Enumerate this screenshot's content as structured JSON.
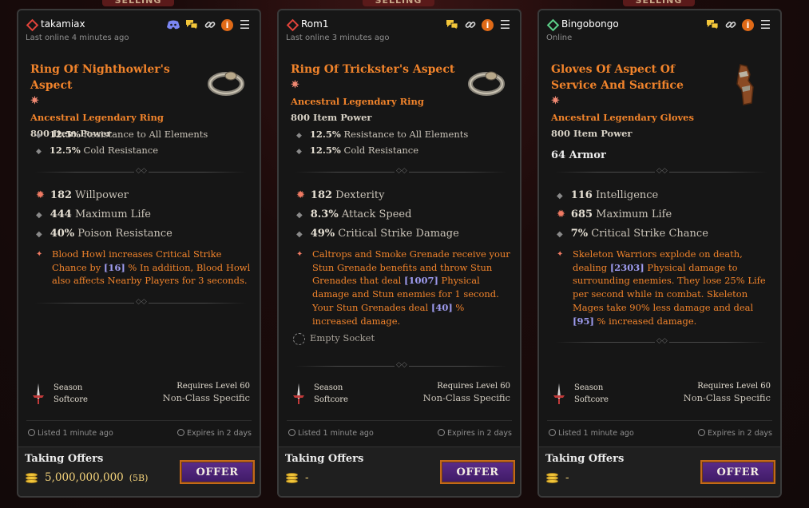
{
  "selling_label": "SELLING",
  "cards": [
    {
      "user": {
        "name": "takamiax",
        "status": "offline",
        "last_online": "Last online 4 minutes ago",
        "discord": true
      },
      "item": {
        "name": "Ring Of Nighthowler's Aspect",
        "type": "Ancestral Legendary Ring",
        "power": "800 Item Power",
        "icon": "ring-icon"
      },
      "implicits": [
        {
          "value": "12.5%",
          "text": " Resistance to All Elements"
        },
        {
          "value": "12.5%",
          "text": " Cold Resistance"
        }
      ],
      "affixes": [
        {
          "value": "182",
          "text": " Willpower",
          "greater": true
        },
        {
          "value": "444",
          "text": " Maximum Life",
          "greater": false
        },
        {
          "value": "40%",
          "text": " Poison Resistance",
          "greater": false
        }
      ],
      "aspect_parts": [
        "Blood Howl increases Critical Strike Chance by ",
        "[16]",
        " % In addition, Blood Howl also affects Nearby Players for 3 seconds."
      ],
      "season": [
        "Season",
        "Softcore"
      ],
      "requires": "Requires Level 60",
      "class_req": "Non-Class Specific",
      "listed": "Listed 1 minute ago",
      "expires": "Expires in 2 days",
      "taking_offers": "Taking Offers",
      "price": "5,000,000,000",
      "price_short": "(5B)",
      "offer_label": "OFFER"
    },
    {
      "user": {
        "name": "Rom1",
        "status": "offline",
        "last_online": "Last online 3 minutes ago",
        "discord": false
      },
      "item": {
        "name": "Ring Of Trickster's Aspect",
        "type": "Ancestral Legendary Ring",
        "power": "800 Item Power",
        "icon": "ring-icon"
      },
      "implicits": [
        {
          "value": "12.5%",
          "text": " Resistance to All Elements"
        },
        {
          "value": "12.5%",
          "text": " Cold Resistance"
        }
      ],
      "affixes": [
        {
          "value": "182",
          "text": " Dexterity",
          "greater": true
        },
        {
          "value": "8.3%",
          "text": " Attack Speed",
          "greater": false
        },
        {
          "value": "49%",
          "text": " Critical Strike Damage",
          "greater": false
        }
      ],
      "aspect_parts": [
        "Caltrops and Smoke Grenade receive your Stun Grenade benefits and throw Stun Grenades that deal ",
        "[1007]",
        " Physical damage and Stun enemies for 1 second. Your Stun Grenades deal ",
        "[40]",
        " % increased damage."
      ],
      "socket": "Empty Socket",
      "season": [
        "Season",
        "Softcore"
      ],
      "requires": "Requires Level 60",
      "class_req": "Non-Class Specific",
      "listed": "Listed 1 minute ago",
      "expires": "Expires in 2 days",
      "taking_offers": "Taking Offers",
      "price": "-",
      "offer_label": "OFFER"
    },
    {
      "user": {
        "name": "Bingobongo",
        "status": "online",
        "last_online": "Online",
        "discord": false
      },
      "item": {
        "name": "Gloves Of Aspect Of Service And Sacrifice",
        "type": "Ancestral Legendary Gloves",
        "power": "800 Item Power",
        "armor": "64 Armor",
        "icon": "gloves-icon"
      },
      "affixes": [
        {
          "value": "116",
          "text": " Intelligence",
          "greater": false
        },
        {
          "value": "685",
          "text": " Maximum Life",
          "greater": true
        },
        {
          "value": "7%",
          "text": " Critical Strike Chance",
          "greater": false
        }
      ],
      "aspect_parts": [
        "Skeleton Warriors explode on death, dealing ",
        "[2303]",
        " Physical damage to surrounding enemies. They lose 25% Life per second while in combat. Skeleton Mages take 90% less damage and deal ",
        "[95]",
        " % increased damage."
      ],
      "season": [
        "Season",
        "Softcore"
      ],
      "requires": "Requires Level 60",
      "class_req": "Non-Class Specific",
      "listed": "Listed 1 minute ago",
      "expires": "Expires in 2 days",
      "taking_offers": "Taking Offers",
      "price": "-",
      "offer_label": "OFFER"
    }
  ]
}
